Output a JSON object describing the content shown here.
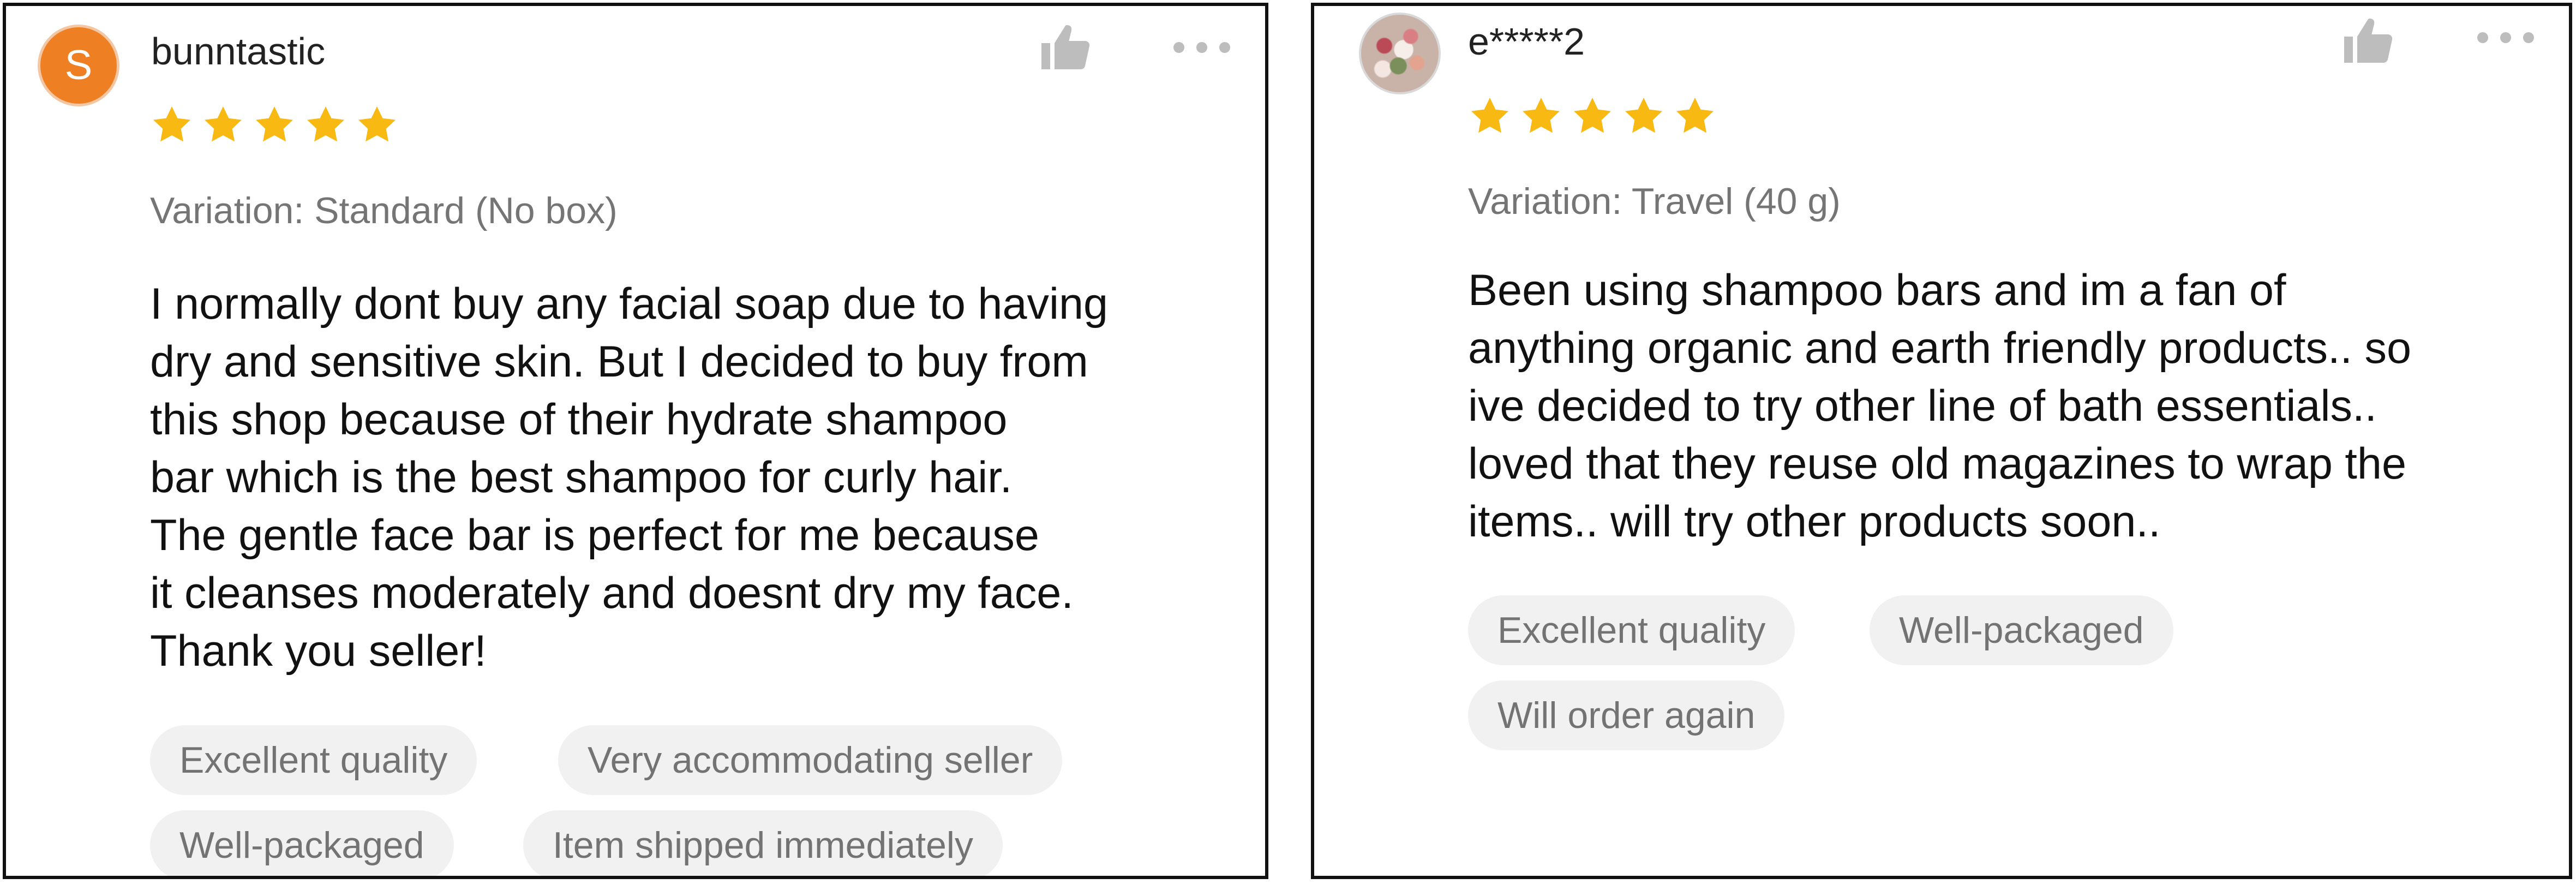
{
  "colors": {
    "star": "#f7b912",
    "avatar_orange": "#ee7f22",
    "tag_background": "#f1f1f1",
    "tag_text": "#737373",
    "icon_gray": "#bdbdbd"
  },
  "reviews": [
    {
      "avatar_letter": "S",
      "username": "bunntastic",
      "rating": 5,
      "variation": "Variation: Standard (No box)",
      "text_lines": [
        "I normally dont buy any facial soap due to having",
        "dry and sensitive skin. But I decided to buy from",
        "this shop because of their hydrate shampoo",
        "bar which is the best shampoo for curly hair.",
        "The gentle face bar is perfect for me because",
        "it cleanses moderately and doesnt dry my face.",
        "Thank you seller!"
      ],
      "tags": [
        "Excellent quality",
        "Very accommodating seller",
        "Well-packaged",
        "Item shipped immediately"
      ],
      "icons": {
        "avatar": "letter-avatar",
        "like": "thumbs-up-icon",
        "more": "more-options-icon"
      }
    },
    {
      "avatar_letter": "",
      "username": "e*****2",
      "rating": 5,
      "variation": "Variation: Travel (40 g)",
      "text_lines": [
        "Been using shampoo bars and im a fan of",
        "anything organic and earth friendly products.. so",
        "ive decided to try other line of bath essentials..",
        "loved that they reuse old magazines to wrap the",
        "items.. will try other products soon.."
      ],
      "tags": [
        "Excellent quality",
        "Well-packaged",
        "Will order again"
      ],
      "icons": {
        "avatar": "profile-photo-avatar",
        "like": "thumbs-up-icon",
        "more": "more-options-icon"
      }
    }
  ]
}
